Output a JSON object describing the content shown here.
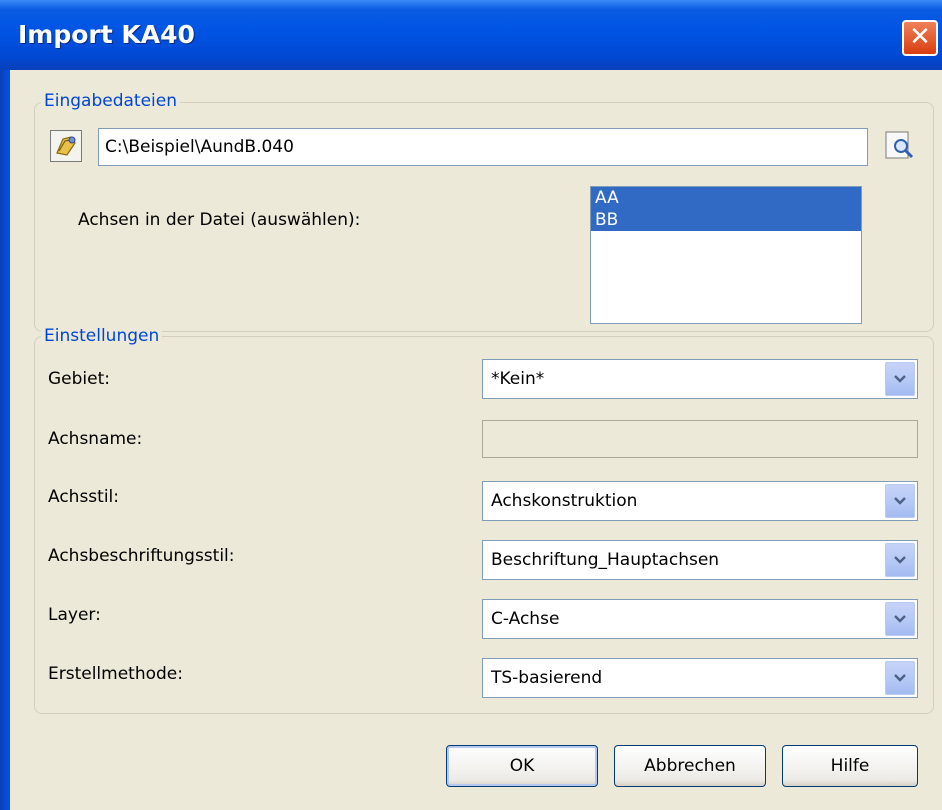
{
  "window": {
    "title": "Import KA40",
    "close_glyph": "✕"
  },
  "input_group": {
    "legend": "Eingabedateien",
    "file_path": "C:\\Beispiel\\AundB.040",
    "axes_label": "Achsen in der Datei (auswählen):",
    "axes_items": [
      "AA",
      "BB"
    ]
  },
  "settings_group": {
    "legend": "Einstellungen",
    "gebiet_label": "Gebiet:",
    "gebiet_value": "*Kein*",
    "achsname_label": "Achsname:",
    "achsname_value": "",
    "achsstil_label": "Achsstil:",
    "achsstil_value": "Achskonstruktion",
    "beschriftung_label": "Achsbeschriftungsstil:",
    "beschriftung_value": "Beschriftung_Hauptachsen",
    "layer_label": "Layer:",
    "layer_value": "C-Achse",
    "methode_label": "Erstellmethode:",
    "methode_value": "TS-basierend"
  },
  "buttons": {
    "ok": "OK",
    "cancel": "Abbrechen",
    "help": "Hilfe"
  },
  "colors": {
    "title_bar": "#0055e5",
    "legend_text": "#0046d5",
    "selection": "#316ac5"
  },
  "icons": [
    "open-file-icon",
    "browse-magnifier-icon",
    "chevron-down-icon",
    "close-icon"
  ]
}
